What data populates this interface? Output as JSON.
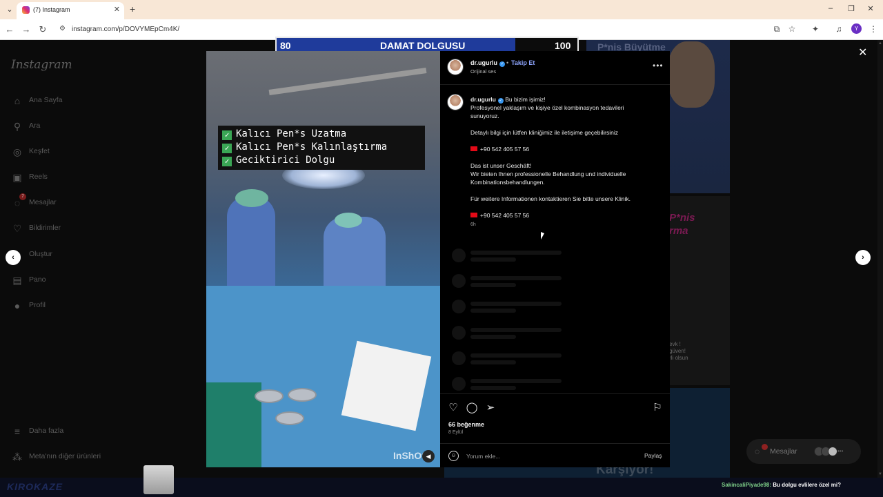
{
  "browser": {
    "tab_title": "(7) Instagram",
    "url": "instagram.com/p/DOVYMEpCm4K/",
    "profile_initial": "Y"
  },
  "sidebar": {
    "logo": "Instagram",
    "items": [
      {
        "label": "Ana Sayfa",
        "icon": "home-icon"
      },
      {
        "label": "Ara",
        "icon": "search-icon"
      },
      {
        "label": "Keşfet",
        "icon": "compass-icon"
      },
      {
        "label": "Reels",
        "icon": "reels-icon"
      },
      {
        "label": "Mesajlar",
        "icon": "messenger-icon",
        "badge": "7"
      },
      {
        "label": "Bildirimler",
        "icon": "heart-icon"
      },
      {
        "label": "Oluştur",
        "icon": "plus-icon"
      },
      {
        "label": "Pano",
        "icon": "dashboard-icon"
      },
      {
        "label": "Profil",
        "icon": "profile-icon"
      }
    ],
    "more": "Daha fazla",
    "meta": "Meta'nın diğer ürünleri"
  },
  "score_banner": {
    "left": "80",
    "title": "DAMAT DOLGUSU",
    "right": "100"
  },
  "media": {
    "overlay_lines": [
      "Kalıcı Pen*s Uzatma",
      "Kalıcı Pen*s Kalınlaştırma",
      "Geciktirici Dolgu"
    ],
    "watermark": "InShOt"
  },
  "post": {
    "username": "dr.ugurlu",
    "follow": "Takip Et",
    "audio": "Orijinal ses",
    "caption_first": "Bu bizim işimiz!",
    "caption_lines": [
      "Profesyonel yaklaşım ve kişiye özel kombinasyon tedavileri",
      "sunuyoruz.",
      "",
      "Detaylı bilgi için lütfen kliniğimiz ile iletişime geçebilirsiniz",
      "",
      "+90 542 405 57 56",
      "",
      "Das ist unser Geschäft!",
      "Wir bieten Ihnen professionelle Behandlung und individuelle",
      "Kombinationsbehandlungen.",
      "",
      "Für weitere Informationen kontaktieren Sie bitte unsere Klinik.",
      "",
      "+90 542 405 57 56"
    ],
    "time": "6h",
    "likes": "66 beğenme",
    "date": "8 Eylül",
    "comment_placeholder": "Yorum ekle...",
    "share": "Paylaş"
  },
  "background_feed": {
    "thumb1": "P*nis Büyütme",
    "thumb2": "P*nis\nrma",
    "thumb2_sub": "evk !\ngüven!\nrli olsun",
    "thumb3": "Karşıyor!"
  },
  "messages_pill": {
    "label": "Mesajlar"
  },
  "stream": {
    "logo": "KIROKAZE",
    "chat_user": "SakincaliPiyade98:",
    "chat_message": " Bu dolgu evlilere özel mi?"
  }
}
